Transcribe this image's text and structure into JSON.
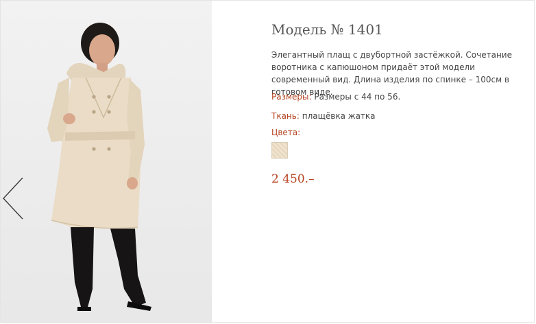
{
  "product": {
    "title": "Модель № 1401",
    "description": "Элегантный плащ  с двубортной застёжкой. Сочетание воротника с капюшоном придаёт этой модели современный вид. Длина изделия по спинке – 100см   в готовом виде.",
    "sizes_label": "Размеры:",
    "sizes_value": "Размеры с 44 по 56.",
    "fabric_label": "Ткань:",
    "fabric_value": "плащёвка жатка",
    "colors_label": "Цвета:",
    "price": "2 450.–"
  },
  "colors": {
    "accent": "#b5421f",
    "text": "#444444",
    "coat": "#e9dcc6",
    "swatch": "#efe3cf"
  },
  "icons": {
    "prev": "chevron-left-icon"
  }
}
